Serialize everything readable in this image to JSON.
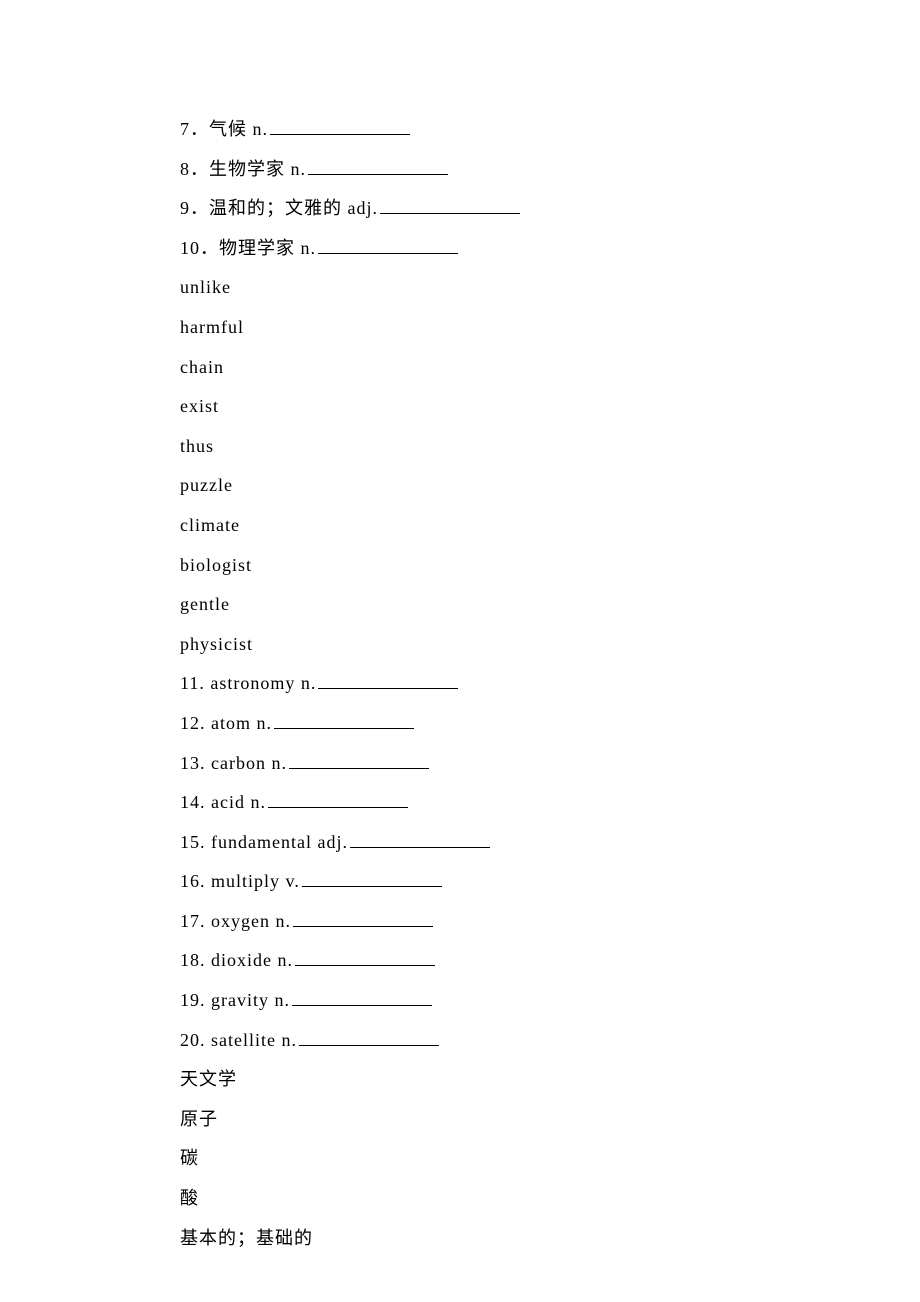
{
  "lines": [
    {
      "num": "7",
      "prompt": "气候 n.",
      "blank": true
    },
    {
      "num": "8",
      "prompt": "生物学家 n.",
      "blank": true
    },
    {
      "num": "9",
      "prompt": "温和的；文雅的 adj.",
      "blank": true
    },
    {
      "num": "10",
      "prompt": "物理学家 n.",
      "blank": true
    },
    {
      "text": "unlike"
    },
    {
      "text": "harmful"
    },
    {
      "text": "chain"
    },
    {
      "text": "exist"
    },
    {
      "text": "thus"
    },
    {
      "text": "puzzle"
    },
    {
      "text": "climate"
    },
    {
      "text": "biologist"
    },
    {
      "text": "gentle"
    },
    {
      "text": "physicist"
    },
    {
      "num": "11",
      "prompt": "astronomy n.",
      "blank": true,
      "sep": ". "
    },
    {
      "num": "12",
      "prompt": "atom n.",
      "blank": true,
      "sep": ". "
    },
    {
      "num": "13",
      "prompt": "carbon n.",
      "blank": true,
      "sep": ". "
    },
    {
      "num": "14",
      "prompt": "acid n.",
      "blank": true,
      "sep": ". "
    },
    {
      "num": "15",
      "prompt": "fundamental adj.",
      "blank": true,
      "sep": ". "
    },
    {
      "num": "16",
      "prompt": "multiply v.",
      "blank": true,
      "sep": ". "
    },
    {
      "num": "17",
      "prompt": "oxygen n.",
      "blank": true,
      "sep": ". "
    },
    {
      "num": "18",
      "prompt": "dioxide n.",
      "blank": true,
      "sep": ". "
    },
    {
      "num": "19",
      "prompt": "gravity n.",
      "blank": true,
      "sep": ". "
    },
    {
      "num": "20",
      "prompt": "satellite n.",
      "blank": true,
      "sep": ". "
    },
    {
      "text": "天文学"
    },
    {
      "text": "原子"
    },
    {
      "text": "碳"
    },
    {
      "text": "酸"
    },
    {
      "text": "基本的；基础的"
    }
  ]
}
